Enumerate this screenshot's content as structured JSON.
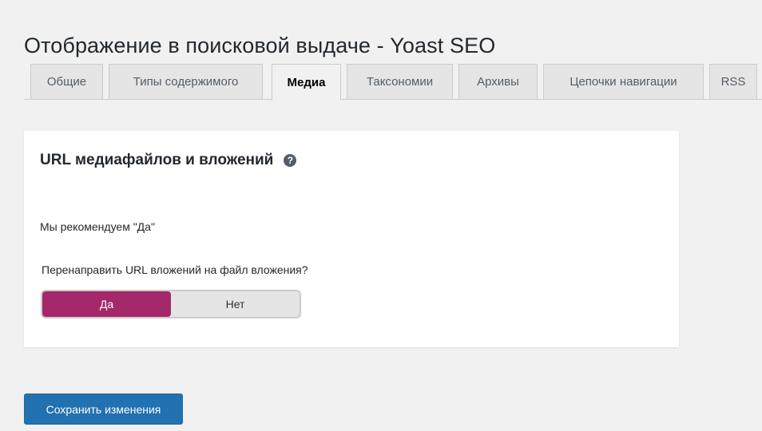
{
  "page": {
    "title": "Отображение в поисковой выдаче - Yoast SEO"
  },
  "tabs": [
    {
      "label": "Общие",
      "active": false
    },
    {
      "label": "Типы содержимого",
      "active": false
    },
    {
      "label": "Медиа",
      "active": true
    },
    {
      "label": "Таксономии",
      "active": false
    },
    {
      "label": "Архивы",
      "active": false
    },
    {
      "label": "Цепочки навигации",
      "active": false
    },
    {
      "label": "RSS",
      "active": false
    }
  ],
  "media_section": {
    "heading": "URL медиафайлов и вложений",
    "help_icon": "question-circle-icon",
    "help_glyph": "?",
    "recommendation": "Мы рекомендуем \"Да\"",
    "redirect_question": "Перенаправить URL вложений на файл вложения?",
    "toggle": {
      "yes_label": "Да",
      "no_label": "Нет",
      "selected": "Да"
    }
  },
  "actions": {
    "save_label": "Сохранить изменения"
  },
  "colors": {
    "toggle_on": "#a4286a",
    "primary_button": "#2271b1",
    "page_background": "#f1f1f1"
  }
}
